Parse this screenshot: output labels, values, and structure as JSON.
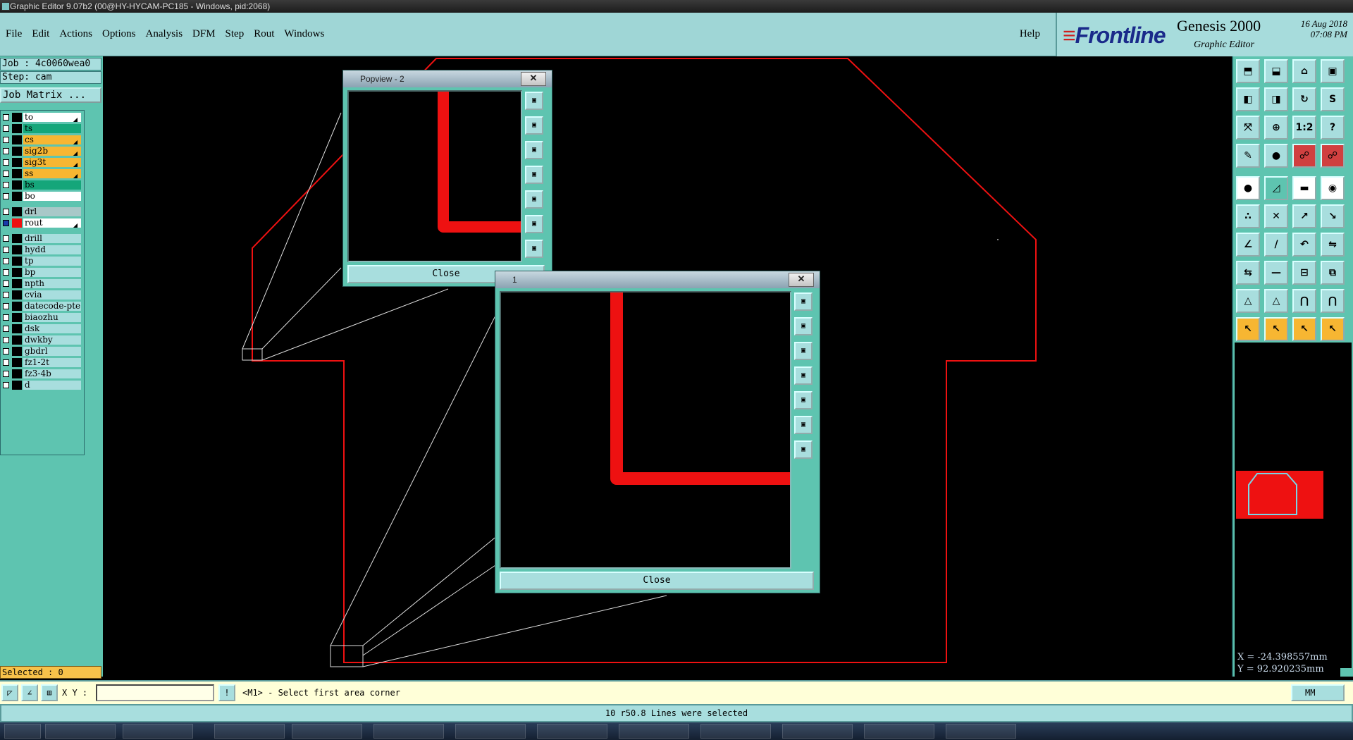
{
  "window": {
    "title": "Graphic Editor 9.07b2 (00@HY-HYCAM-PC185 - Windows, pid:2068)"
  },
  "menu": {
    "items": [
      {
        "label": "File"
      },
      {
        "label": "Edit"
      },
      {
        "label": "Actions"
      },
      {
        "label": "Options"
      },
      {
        "label": "Analysis"
      },
      {
        "label": "DFM"
      },
      {
        "label": "Step"
      },
      {
        "label": "Rout"
      },
      {
        "label": "Windows"
      }
    ],
    "help": "Help"
  },
  "brand": {
    "logo": "Frontline",
    "product": "Genesis 2000",
    "subtitle": "Graphic Editor",
    "date": "16 Aug 2018",
    "time": "07:08 PM"
  },
  "job": {
    "job_line": "Job : 4c0060wea0",
    "step_line": "Step: cam",
    "matrix_button": "Job Matrix ..."
  },
  "layers": [
    {
      "name": "to",
      "color": "#ffffff",
      "arrow": true
    },
    {
      "name": "ts",
      "color": "#15a67a",
      "arrow": false
    },
    {
      "name": "cs",
      "color": "#f7b632",
      "arrow": true
    },
    {
      "name": "sig2b",
      "color": "#f7b632",
      "arrow": true
    },
    {
      "name": "sig3t",
      "color": "#f7b632",
      "arrow": true
    },
    {
      "name": "ss",
      "color": "#f7b632",
      "arrow": true
    },
    {
      "name": "bs",
      "color": "#15a67a",
      "arrow": false
    },
    {
      "name": "bo",
      "color": "#ffffff",
      "arrow": false
    },
    {
      "name": "drl",
      "color": "#a8c8c8",
      "arrow": false,
      "gap": true
    },
    {
      "name": "rout",
      "color": "#ffffff",
      "arrow": true,
      "active": true
    },
    {
      "name": "drill",
      "color": "#a8dede",
      "arrow": false,
      "gap": true
    },
    {
      "name": "hydd",
      "color": "#a8dede",
      "arrow": false
    },
    {
      "name": "tp",
      "color": "#a8dede",
      "arrow": false
    },
    {
      "name": "bp",
      "color": "#a8dede",
      "arrow": false
    },
    {
      "name": "npth",
      "color": "#a8dede",
      "arrow": false
    },
    {
      "name": "cvia",
      "color": "#a8dede",
      "arrow": false
    },
    {
      "name": "datecode-pte",
      "color": "#a8dede",
      "arrow": false
    },
    {
      "name": "biaozhu",
      "color": "#a8dede",
      "arrow": false
    },
    {
      "name": "dsk",
      "color": "#a8dede",
      "arrow": false
    },
    {
      "name": "dwkby",
      "color": "#a8dede",
      "arrow": false
    },
    {
      "name": "gbdrl",
      "color": "#a8dede",
      "arrow": false
    },
    {
      "name": "fz1-2t",
      "color": "#a8dede",
      "arrow": false
    },
    {
      "name": "fz3-4b",
      "color": "#a8dede",
      "arrow": false
    },
    {
      "name": "d",
      "color": "#a8dede",
      "arrow": false
    }
  ],
  "selected": "Selected : 0",
  "popview2": {
    "title": "Popview - 2",
    "close": "Close"
  },
  "popview1": {
    "title": "1",
    "close": "Close"
  },
  "coords": {
    "x": "X = -24.398557mm",
    "y": "Y = 92.920235mm"
  },
  "command": {
    "xy_label": "X Y :",
    "xy_value": "",
    "prompt": "<M1> - Select first area corner",
    "units": "MM"
  },
  "status": "10 r50.8 Lines were selected",
  "icons": {
    "toolbar": [
      "zoom-home-icon",
      "zoom-out-icon",
      "home-icon",
      "window-icon",
      "pan-left-icon",
      "pan-right-icon",
      "redraw-icon",
      "snap-icon",
      "fit-icon",
      "center-icon",
      "ratio-icon",
      "help-icon",
      "measure-icon",
      "pin-icon",
      "netlist-icon",
      "netlist-alt-icon",
      "pad-icon",
      "line-icon",
      "dash-icon",
      "circle-icon",
      "connect-icon",
      "cross-icon",
      "segment-icon",
      "extend-icon",
      "angle-icon",
      "slash-icon",
      "arc-icon",
      "mirror-icon",
      "move-icon",
      "minus-icon",
      "align-icon",
      "copy-icon",
      "triangle-icon",
      "triangle-outline-icon",
      "arch-icon",
      "arch-cut-icon",
      "pointer-icon",
      "pointer-select-icon",
      "pointer-alt-icon",
      "pointer-route-icon"
    ]
  },
  "colors": {
    "accent": "#a8dede",
    "panel": "#5ec4b0",
    "outline": "#ee1111"
  }
}
